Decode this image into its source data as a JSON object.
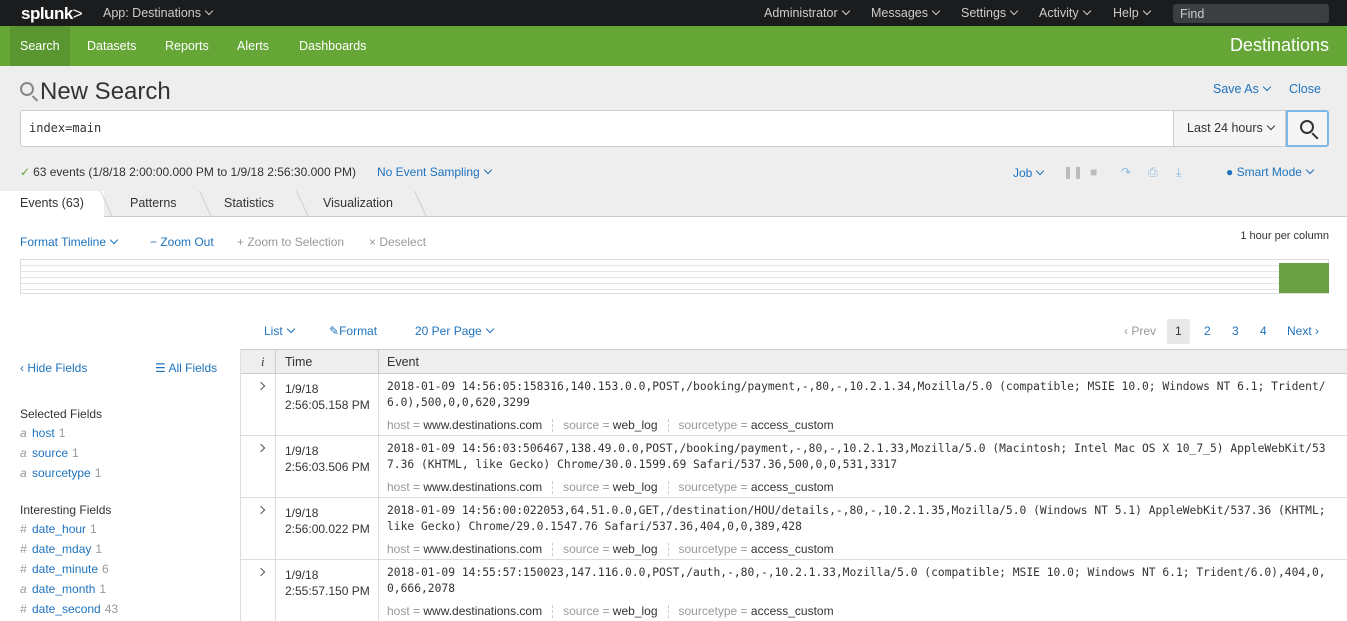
{
  "topbar": {
    "logo": "splunk",
    "logo_chevron": ">",
    "app_menu": "App: Destinations",
    "nav": [
      "Administrator",
      "Messages",
      "Settings",
      "Activity",
      "Help"
    ],
    "find_placeholder": "Find"
  },
  "appbar": {
    "nav": [
      "Search",
      "Datasets",
      "Reports",
      "Alerts",
      "Dashboards"
    ],
    "active": "Search",
    "title": "Destinations",
    "color": "#65a637"
  },
  "search": {
    "title": "New Search",
    "save_as": "Save As",
    "close": "Close",
    "query": "index=main",
    "time_range": "Last 24 hours",
    "status_check": "✓",
    "status": "63 events (1/8/18 2:00:00.000 PM to 1/9/18 2:56:30.000 PM)",
    "sampling": "No Event Sampling",
    "job": "Job",
    "mode": "Smart Mode"
  },
  "tabs": [
    "Events (63)",
    "Patterns",
    "Statistics",
    "Visualization"
  ],
  "timeline": {
    "format": "Format Timeline",
    "zoom_out": "− Zoom Out",
    "zoom_selection": "+ Zoom to Selection",
    "deselect": "× Deselect",
    "scale": "1 hour per column"
  },
  "results_toolbar": {
    "list": "List",
    "format": "Format",
    "per_page": "20 Per Page",
    "prev": "‹ Prev",
    "pages": [
      "1",
      "2",
      "3",
      "4"
    ],
    "next": "Next ›"
  },
  "sidebar": {
    "hide_fields": "‹ Hide Fields",
    "all_fields": "All Fields",
    "selected_heading": "Selected Fields",
    "selected": [
      {
        "type": "a",
        "name": "host",
        "count": "1"
      },
      {
        "type": "a",
        "name": "source",
        "count": "1"
      },
      {
        "type": "a",
        "name": "sourcetype",
        "count": "1"
      }
    ],
    "interesting_heading": "Interesting Fields",
    "interesting": [
      {
        "type": "#",
        "name": "date_hour",
        "count": "1"
      },
      {
        "type": "#",
        "name": "date_mday",
        "count": "1"
      },
      {
        "type": "#",
        "name": "date_minute",
        "count": "6"
      },
      {
        "type": "a",
        "name": "date_month",
        "count": "1"
      },
      {
        "type": "#",
        "name": "date_second",
        "count": "43"
      }
    ]
  },
  "table": {
    "headers": [
      "i",
      "Time",
      "Event"
    ],
    "meta_labels": {
      "host": "host =",
      "source": "source =",
      "sourcetype": "sourcetype ="
    },
    "rows": [
      {
        "date": "1/9/18",
        "time": "2:56:05.158 PM",
        "raw": "2018-01-09 14:56:05:158316,140.153.0.0,POST,/booking/payment,-,80,-,10.2.1.34,Mozilla/5.0 (compatible; MSIE 10.0; Windows NT 6.1; Trident/6.0),500,0,0,620,3299",
        "host": "www.destinations.com",
        "source": "web_log",
        "sourcetype": "access_custom"
      },
      {
        "date": "1/9/18",
        "time": "2:56:03.506 PM",
        "raw": "2018-01-09 14:56:03:506467,138.49.0.0,POST,/booking/payment,-,80,-,10.2.1.33,Mozilla/5.0 (Macintosh; Intel Mac OS X 10_7_5) AppleWebKit/537.36 (KHTML, like Gecko) Chrome/30.0.1599.69 Safari/537.36,500,0,0,531,3317",
        "host": "www.destinations.com",
        "source": "web_log",
        "sourcetype": "access_custom"
      },
      {
        "date": "1/9/18",
        "time": "2:56:00.022 PM",
        "raw": "2018-01-09 14:56:00:022053,64.51.0.0,GET,/destination/HOU/details,-,80,-,10.2.1.35,Mozilla/5.0 (Windows NT 5.1) AppleWebKit/537.36 (KHTML; like Gecko) Chrome/29.0.1547.76 Safari/537.36,404,0,0,389,428",
        "host": "www.destinations.com",
        "source": "web_log",
        "sourcetype": "access_custom"
      },
      {
        "date": "1/9/18",
        "time": "2:55:57.150 PM",
        "raw": "2018-01-09 14:55:57:150023,147.116.0.0,POST,/auth,-,80,-,10.2.1.33,Mozilla/5.0 (compatible; MSIE 10.0; Windows NT 6.1; Trident/6.0),404,0,0,666,2078",
        "host": "www.destinations.com",
        "source": "web_log",
        "sourcetype": "access_custom"
      }
    ]
  }
}
